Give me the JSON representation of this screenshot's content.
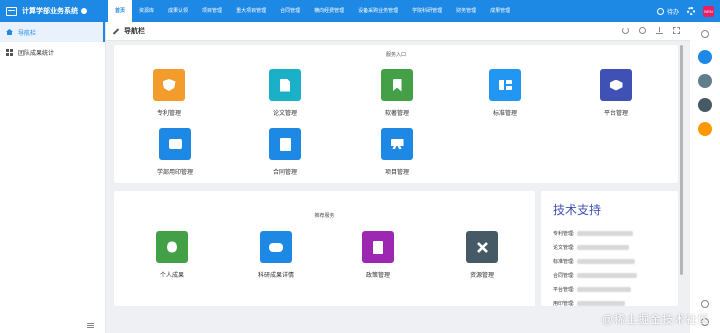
{
  "app": {
    "title": "计算学部业务系统",
    "user_badge": "BRN"
  },
  "nav": {
    "items": [
      "首页",
      "资源库",
      "成果认领",
      "项目管理",
      "重大项目管理",
      "合同管理",
      "横向经费管理",
      "设备采购业务管理",
      "学院科研管理",
      "财务管理",
      "成果管理"
    ],
    "todo_label": "待办"
  },
  "sidebar": {
    "items": [
      {
        "label": "导航栏",
        "active": true
      },
      {
        "label": "团队成果统计",
        "active": false
      }
    ]
  },
  "breadcrumb": {
    "title": "导航栏"
  },
  "service_section": {
    "title": "服务入口",
    "tiles": [
      {
        "label": "专利管理",
        "color": "#f39c2c",
        "icon": "shield-check-icon"
      },
      {
        "label": "论文管理",
        "color": "#1ab0c8",
        "icon": "document-icon"
      },
      {
        "label": "软著管理",
        "color": "#43a047",
        "icon": "bookmark-icon"
      },
      {
        "label": "标准管理",
        "color": "#2196f3",
        "icon": "table-icon"
      },
      {
        "label": "平台管理",
        "color": "#3f51b5",
        "icon": "layers-icon"
      },
      {
        "label": "学部用印管理",
        "color": "#1e88e5",
        "icon": "seal-icon"
      },
      {
        "label": "合同管理",
        "color": "#1e88e5",
        "icon": "contract-icon"
      },
      {
        "label": "项目管理",
        "color": "#1e88e5",
        "icon": "presentation-board-icon"
      }
    ]
  },
  "recommend_section": {
    "title": "推荐服务",
    "tiles": [
      {
        "label": "个人成果",
        "color": "#43a047",
        "icon": "person-icon"
      },
      {
        "label": "科研成果详情",
        "color": "#1e88e5",
        "icon": "group-icon"
      },
      {
        "label": "政策管理",
        "color": "#9c27b0",
        "icon": "book-icon"
      },
      {
        "label": "资源管理",
        "color": "#455a64",
        "icon": "tools-icon"
      }
    ]
  },
  "support": {
    "title": "技术支持",
    "rows": [
      "专利管理:",
      "论文管理:",
      "标准管理:",
      "合同管理:",
      "平台管理:",
      "用印管理:"
    ]
  },
  "rail": {
    "colors": [
      "#1e88e5",
      "#607d8b",
      "#455a64",
      "#ff9800"
    ]
  },
  "watermark": "@稀土掘金技术社区"
}
